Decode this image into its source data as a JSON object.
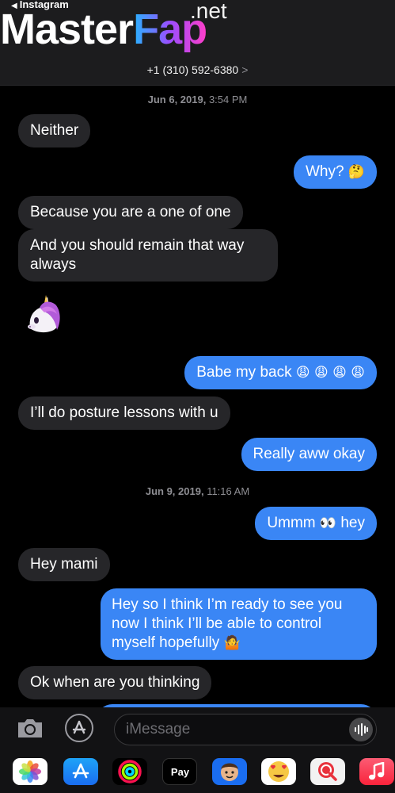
{
  "header": {
    "back_label": "Instagram",
    "watermark_master": "Master",
    "watermark_fap": "Fap",
    "watermark_net": ".net",
    "phone_number": "+1 (310) 592-6380",
    "phone_chevron": ">"
  },
  "timestamps": [
    {
      "date": "Jun 6, 2019,",
      "time": "3:54 PM"
    },
    {
      "date": "Jun 9, 2019,",
      "time": "11:16 AM"
    }
  ],
  "messages": [
    {
      "dir": "in",
      "text": "Neither"
    },
    {
      "dir": "out",
      "text": "Why?",
      "emoji": "🤔"
    },
    {
      "dir": "in",
      "text": "Because you are a one of one"
    },
    {
      "dir": "in",
      "text": "And you should remain that way always"
    },
    {
      "dir": "out",
      "text": "Babe my back",
      "emoji": "😩 😩 😩 😩"
    },
    {
      "dir": "in",
      "text": "I’ll do posture lessons with u"
    },
    {
      "dir": "out",
      "text": "Really aww okay"
    },
    {
      "dir": "out",
      "text": "Ummm",
      "emoji_mid": "👀",
      "text_after": "hey"
    },
    {
      "dir": "in",
      "text": "Hey mami"
    },
    {
      "dir": "out",
      "text": "Hey so I think I’m ready to see you now I think I’ll be able to control myself hopefully",
      "emoji": "🤷"
    },
    {
      "dir": "in",
      "text": "Ok when are you thinking"
    }
  ],
  "sticker": {
    "name": "unicorn-memoji"
  },
  "input": {
    "placeholder": "iMessage"
  },
  "drawer": {
    "apps": [
      "photos",
      "app-store",
      "activity",
      "apple-pay",
      "memoji",
      "animoji",
      "web-search",
      "music"
    ],
    "pay_label": "Pay"
  },
  "colors": {
    "incoming": "#262629",
    "outgoing": "#3a86f5",
    "background": "#000000",
    "header": "#1c1c1e"
  }
}
